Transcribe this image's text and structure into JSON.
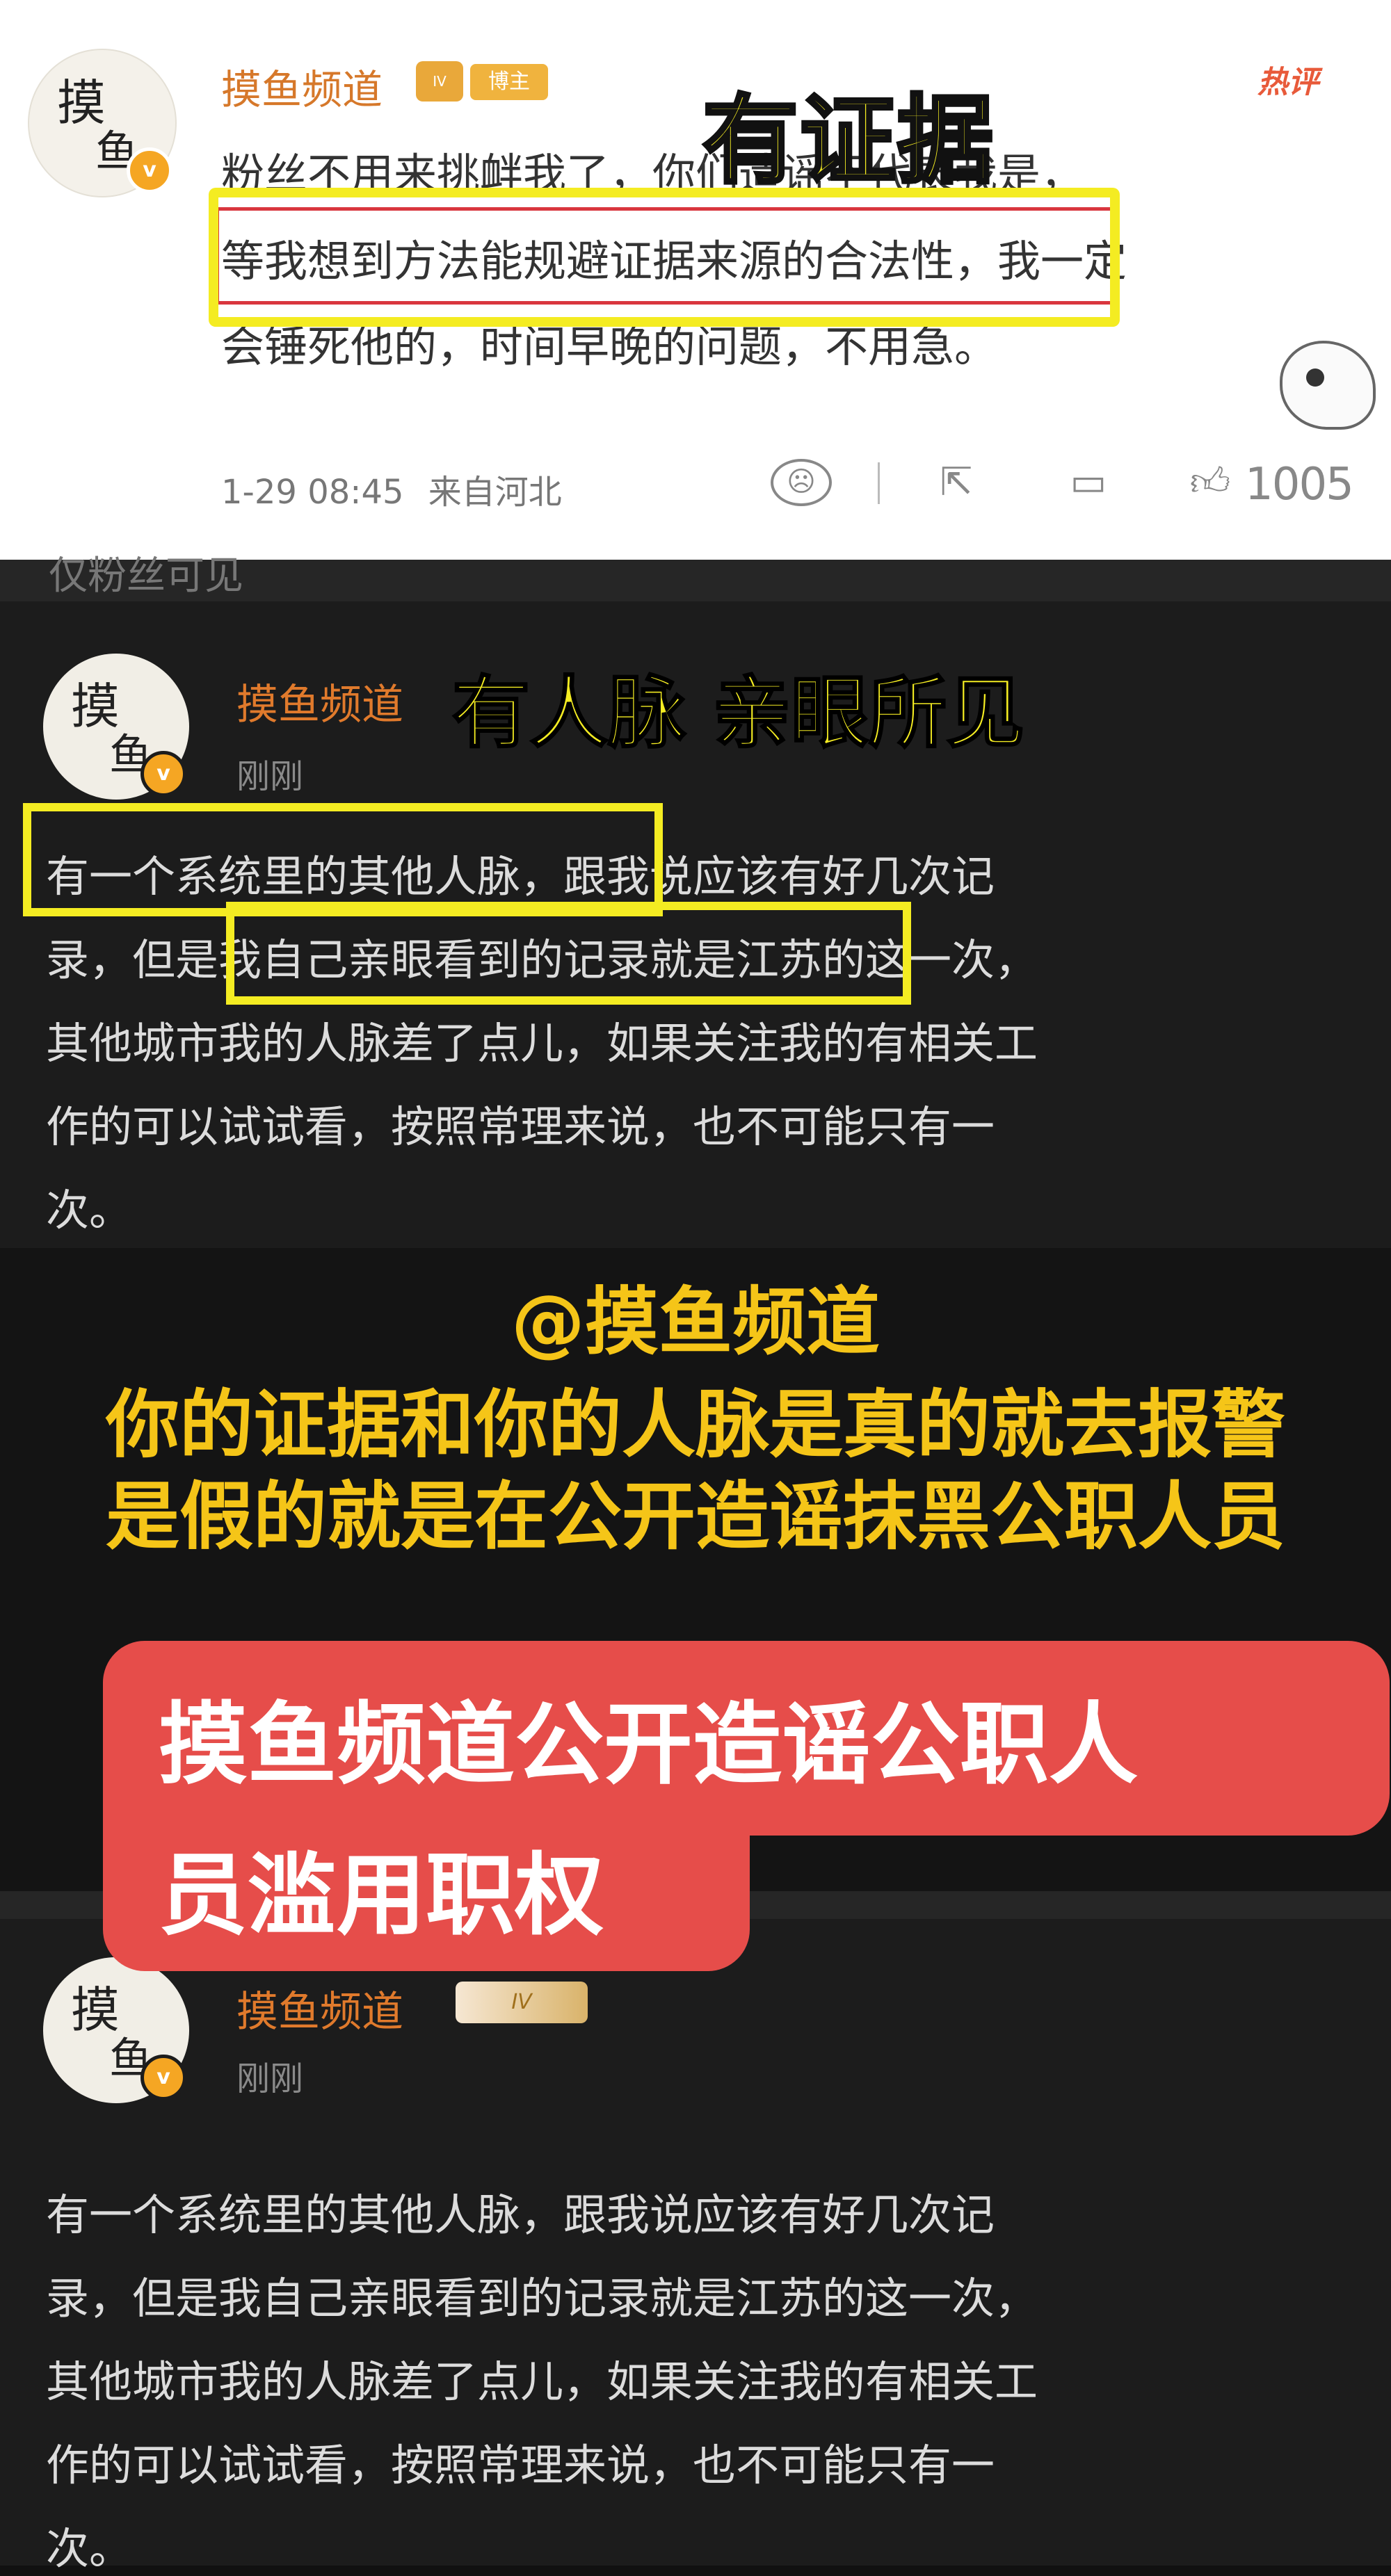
{
  "panel1": {
    "author": "摸鱼频道",
    "badge_level": "IV",
    "badge_label": "博主",
    "hot_label": "热评",
    "lines": [
      "粉丝不用来挑衅我了，你们造谣不代表我是，",
      "等我想到方法能规避证据来源的合法性，我一定",
      "会锤死他的，时间早晚的问题，不用急。"
    ],
    "timestamp": "1-29 08:45",
    "location": "来自河北",
    "like_count": "1005",
    "overlay_title": "有证据"
  },
  "panel2": {
    "strip_text": "仅粉丝可见",
    "author": "摸鱼频道",
    "time": "刚刚",
    "overlay_title": "有人脉 亲眼所见",
    "lines": [
      "有一个系统里的其他人脉，跟我说应该有好几次记",
      "录，但是我自己亲眼看到的记录就是江苏的这一次，",
      "其他城市我的人脉差了点儿，如果关注我的有相关工",
      "作的可以试试看，按照常理来说，也不可能只有一",
      "次。"
    ]
  },
  "banner": {
    "lines": [
      "@摸鱼频道",
      "你的证据和你的人脉是真的就去报警",
      "是假的就是在公开造谣抹黑公职人员"
    ]
  },
  "red_callout": {
    "lines": [
      "摸鱼频道公开造谣公职人",
      "员滥用职权"
    ]
  },
  "panel3": {
    "author": "摸鱼频道",
    "badge_level": "IV",
    "time": "刚刚",
    "lines": [
      "有一个系统里的其他人脉，跟我说应该有好几次记",
      "录，但是我自己亲眼看到的记录就是江苏的这一次，",
      "其他城市我的人脉差了点儿，如果关注我的有相关工",
      "作的可以试试看，按照常理来说，也不可能只有一",
      "次。"
    ]
  },
  "avatar_chars": [
    "摸",
    "鱼"
  ],
  "verified_mark": "v",
  "icons": {
    "dislike": "frown-icon",
    "share": "share-icon",
    "comment": "comment-icon",
    "like": "thumbs-up-icon"
  },
  "colors": {
    "highlight_yellow": "#f4ec22",
    "banner_yellow": "#f5c518",
    "callout_red": "#e64d4a",
    "author_orange": "#e07a2c"
  }
}
